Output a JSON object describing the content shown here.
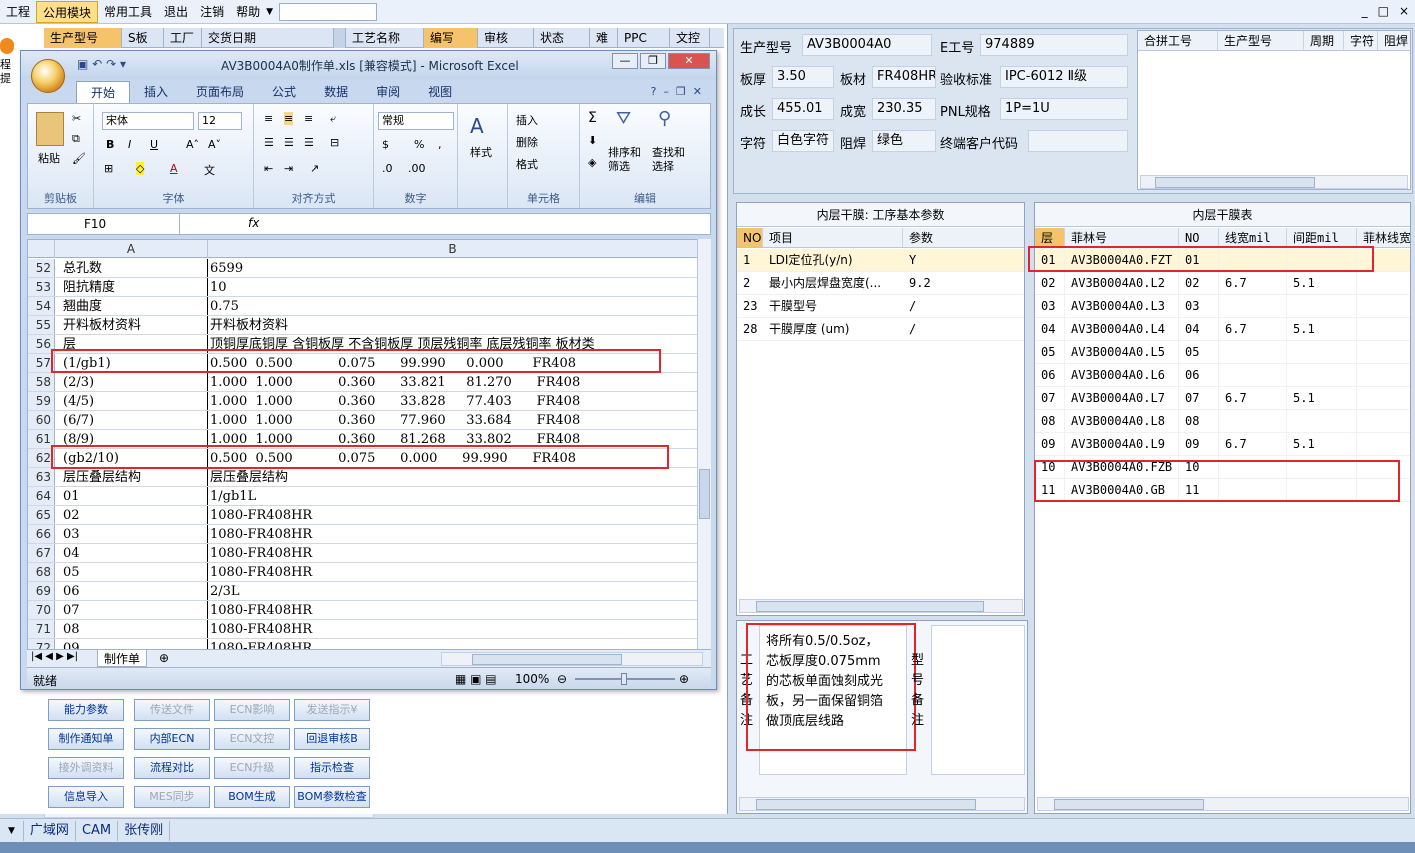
{
  "menubar": {
    "items": [
      "工程",
      "公用模块",
      "常用工具",
      "退出",
      "注销",
      "帮助"
    ],
    "active_index": 1,
    "window_controls": [
      "_",
      "□",
      "×"
    ]
  },
  "bg_table": {
    "left_headers": [
      "生产型号",
      "S板",
      "工厂",
      "交货日期"
    ],
    "right_headers": [
      "工艺名称",
      "编写",
      "审核",
      "状态",
      "难",
      "PPC",
      "文控"
    ]
  },
  "side_strip": [
    "程",
    "提"
  ],
  "action_buttons": [
    {
      "label": "能力参数",
      "enabled": true
    },
    {
      "label": "传送文件",
      "enabled": false
    },
    {
      "label": "ECN影响",
      "enabled": false
    },
    {
      "label": "发送指示¥",
      "enabled": false
    },
    {
      "label": "制作通知单",
      "enabled": true
    },
    {
      "label": "内部ECN",
      "enabled": true
    },
    {
      "label": "ECN文控",
      "enabled": false
    },
    {
      "label": "回退审核B",
      "enabled": true
    },
    {
      "label": "接外调资料",
      "enabled": false
    },
    {
      "label": "流程对比",
      "enabled": true
    },
    {
      "label": "ECN升级",
      "enabled": false
    },
    {
      "label": "指示检查",
      "enabled": true
    },
    {
      "label": "信息导入",
      "enabled": true
    },
    {
      "label": "MES同步",
      "enabled": false
    },
    {
      "label": "BOM生成",
      "enabled": true
    },
    {
      "label": "BOM参数检查",
      "enabled": true
    }
  ],
  "excel": {
    "title": "AV3B0004A0制作单.xls  [兼容模式] - Microsoft Excel",
    "tabs": [
      "开始",
      "插入",
      "页面布局",
      "公式",
      "数据",
      "审阅",
      "视图"
    ],
    "font_name": "宋体",
    "font_size": "12",
    "number_format": "常规",
    "groups": [
      "剪贴板",
      "字体",
      "对齐方式",
      "数字",
      "单元格",
      "编辑"
    ],
    "labels": {
      "paste": "粘贴",
      "styles": "样式",
      "insert": "插入",
      "delete": "删除",
      "format": "格式",
      "sort": "排序和\n筛选",
      "find": "查找和\n选择"
    },
    "name_box": "F10",
    "fx": "fx",
    "columns": [
      "A",
      "B"
    ],
    "rows": [
      {
        "n": "52",
        "a": "总孔数",
        "b": "6599"
      },
      {
        "n": "53",
        "a": "阻抗精度",
        "b": "10"
      },
      {
        "n": "54",
        "a": "翘曲度",
        "b": "0.75"
      },
      {
        "n": "55",
        "a": "开料板材资料",
        "b": "开料板材资料"
      },
      {
        "n": "56",
        "a": "层",
        "b": "顶铜厚底铜厚 含铜板厚 不含铜板厚 顶层残铜率 底层残铜率 板材类"
      },
      {
        "n": "57",
        "a": "(1/gb1)",
        "b": "0.500  0.500           0.075      99.990     0.000       FR408"
      },
      {
        "n": "58",
        "a": "(2/3)",
        "b": "1.000  1.000           0.360      33.821     81.270      FR408"
      },
      {
        "n": "59",
        "a": "(4/5)",
        "b": "1.000  1.000           0.360      33.828     77.403      FR408"
      },
      {
        "n": "60",
        "a": "(6/7)",
        "b": "1.000  1.000           0.360      77.960     33.684      FR408"
      },
      {
        "n": "61",
        "a": "(8/9)",
        "b": "1.000  1.000           0.360      81.268     33.802      FR408"
      },
      {
        "n": "62",
        "a": "(gb2/10)",
        "b": "0.500  0.500           0.075      0.000      99.990      FR408"
      },
      {
        "n": "63",
        "a": "层压叠层结构",
        "b": "层压叠层结构"
      },
      {
        "n": "64",
        "a": "01",
        "b": "1/gb1L"
      },
      {
        "n": "65",
        "a": "02",
        "b": "1080-FR408HR"
      },
      {
        "n": "66",
        "a": "03",
        "b": "1080-FR408HR"
      },
      {
        "n": "67",
        "a": "04",
        "b": "1080-FR408HR"
      },
      {
        "n": "68",
        "a": "05",
        "b": "1080-FR408HR"
      },
      {
        "n": "69",
        "a": "06",
        "b": "2/3L"
      },
      {
        "n": "70",
        "a": "07",
        "b": "1080-FR408HR"
      },
      {
        "n": "71",
        "a": "08",
        "b": "1080-FR408HR"
      },
      {
        "n": "72",
        "a": "09",
        "b": "1080-FR408HR"
      }
    ],
    "sheet_tab": "制作单",
    "status": "就绪",
    "zoom": "100%"
  },
  "info": {
    "fields": [
      {
        "label": "生产型号",
        "value": "AV3B0004A0"
      },
      {
        "label": "E工号",
        "value": "974889"
      },
      {
        "label": "板厚",
        "value": "3.50"
      },
      {
        "label": "板材",
        "value": "FR408HR"
      },
      {
        "label": "验收标准",
        "value": "IPC-6012 Ⅱ级"
      },
      {
        "label": "成长",
        "value": "455.01"
      },
      {
        "label": "成宽",
        "value": "230.35"
      },
      {
        "label": "PNL规格",
        "value": "1P=1U"
      },
      {
        "label": "字符",
        "value": "白色字符"
      },
      {
        "label": "阻焊",
        "value": "绿色"
      },
      {
        "label": "终端客户代码",
        "value": ""
      }
    ],
    "merge_headers": [
      "合拼工号",
      "生产型号",
      "周期",
      "字符",
      "阻焊"
    ]
  },
  "param_panel": {
    "title": "内层干膜: 工序基本参数",
    "headers": [
      "NO",
      "项目",
      "参数"
    ],
    "rows": [
      {
        "no": "1",
        "item": "LDI定位孔(y/n)",
        "val": "Y"
      },
      {
        "no": "2",
        "item": "最小内层焊盘宽度(...",
        "val": "9.2"
      },
      {
        "no": "23",
        "item": "干膜型号",
        "val": "/"
      },
      {
        "no": "28",
        "item": "干膜厚度 (um)",
        "val": "/"
      }
    ]
  },
  "film_panel": {
    "title": "内层干膜表",
    "headers": [
      "层",
      "菲林号",
      "NO",
      "线宽mil",
      "间距mil",
      "菲林线宽"
    ],
    "rows": [
      {
        "layer": "01",
        "film": "AV3B0004A0.FZT",
        "no": "01",
        "w": "",
        "s": ""
      },
      {
        "layer": "02",
        "film": "AV3B0004A0.L2",
        "no": "02",
        "w": "6.7",
        "s": "5.1"
      },
      {
        "layer": "03",
        "film": "AV3B0004A0.L3",
        "no": "03",
        "w": "",
        "s": ""
      },
      {
        "layer": "04",
        "film": "AV3B0004A0.L4",
        "no": "04",
        "w": "6.7",
        "s": "5.1"
      },
      {
        "layer": "05",
        "film": "AV3B0004A0.L5",
        "no": "05",
        "w": "",
        "s": ""
      },
      {
        "layer": "06",
        "film": "AV3B0004A0.L6",
        "no": "06",
        "w": "",
        "s": ""
      },
      {
        "layer": "07",
        "film": "AV3B0004A0.L7",
        "no": "07",
        "w": "6.7",
        "s": "5.1"
      },
      {
        "layer": "08",
        "film": "AV3B0004A0.L8",
        "no": "08",
        "w": "",
        "s": ""
      },
      {
        "layer": "09",
        "film": "AV3B0004A0.L9",
        "no": "09",
        "w": "6.7",
        "s": "5.1"
      },
      {
        "layer": "10",
        "film": "AV3B0004A0.FZB",
        "no": "10",
        "w": "",
        "s": ""
      },
      {
        "layer": "11",
        "film": "AV3B0004A0.GB",
        "no": "11",
        "w": "",
        "s": ""
      }
    ]
  },
  "notes": {
    "left_label": [
      "工",
      "艺",
      "备",
      "注"
    ],
    "text": "将所有0.5/0.5oz，芯板厚度0.075mm的芯板单面蚀刻成光板，另一面保留铜箔做顶底层线路",
    "right_label": [
      "型",
      "号",
      "备",
      "注"
    ]
  },
  "taskbar": [
    "广域网",
    "CAM",
    "张传刚"
  ],
  "colors": {
    "accent": "#ffe08a",
    "red_highlight": "#e0262a",
    "link_blue": "#003399"
  }
}
